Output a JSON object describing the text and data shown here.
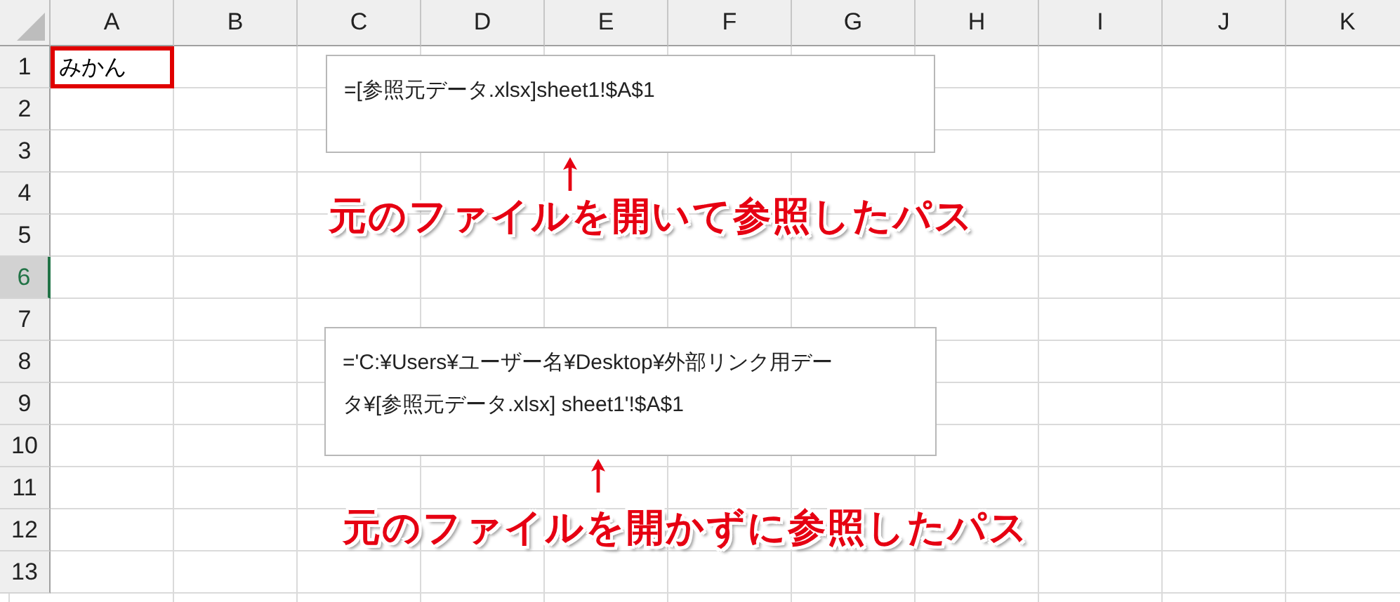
{
  "columns": [
    {
      "label": "A",
      "selected": false
    },
    {
      "label": "B",
      "selected": false
    },
    {
      "label": "C",
      "selected": false
    },
    {
      "label": "D",
      "selected": false
    },
    {
      "label": "E",
      "selected": false
    },
    {
      "label": "F",
      "selected": false
    },
    {
      "label": "G",
      "selected": false
    },
    {
      "label": "H",
      "selected": false
    },
    {
      "label": "I",
      "selected": false
    },
    {
      "label": "J",
      "selected": false
    },
    {
      "label": "K",
      "selected": false
    }
  ],
  "rows": [
    {
      "label": "1",
      "selected": false,
      "cells": [
        {
          "text": "みかん",
          "outlined": true
        }
      ]
    },
    {
      "label": "2",
      "selected": false
    },
    {
      "label": "3",
      "selected": false
    },
    {
      "label": "4",
      "selected": false
    },
    {
      "label": "5",
      "selected": false
    },
    {
      "label": "6",
      "selected": true
    },
    {
      "label": "7",
      "selected": false
    },
    {
      "label": "8",
      "selected": false
    },
    {
      "label": "9",
      "selected": false
    },
    {
      "label": "10",
      "selected": false
    },
    {
      "label": "11",
      "selected": false
    },
    {
      "label": "12",
      "selected": false
    },
    {
      "label": "13",
      "selected": false
    }
  ],
  "callouts": [
    {
      "formula": "=[参照元データ.xlsx]sheet1!$A$1",
      "caption": "元のファイルを開いて参照したパス"
    },
    {
      "formula": "='C:¥Users¥ユーザー名¥Desktop¥外部リンク用データ¥[参照元データ.xlsx] sheet1'!$A$1",
      "caption": "元のファイルを開かずに参照したパス"
    }
  ]
}
